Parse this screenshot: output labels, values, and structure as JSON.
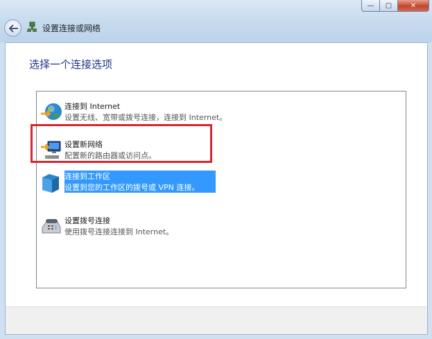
{
  "window": {
    "title": "设置连接或网络",
    "controls": {
      "minimize": "—",
      "maximize": "▢",
      "close": "✕"
    }
  },
  "heading": "选择一个连接选项",
  "options": [
    {
      "title": "连接到 Internet",
      "desc": "设置无线、宽带或拨号连接，连接到 Internet。",
      "icon": "globe-internet-icon"
    },
    {
      "title": "设置新网络",
      "desc": "配置新的路由器或访问点。",
      "icon": "new-network-router-icon"
    },
    {
      "title": "连接到工作区",
      "desc": "设置到您的工作区的拨号或 VPN 连接。",
      "icon": "workplace-vpn-icon",
      "selected": true
    },
    {
      "title": "设置拨号连接",
      "desc": "使用拨号连接连接到 Internet。",
      "icon": "dialup-modem-icon"
    }
  ],
  "colors": {
    "selection": "#3399ff",
    "heading": "#1e3287",
    "highlight_frame": "#d8262f"
  }
}
